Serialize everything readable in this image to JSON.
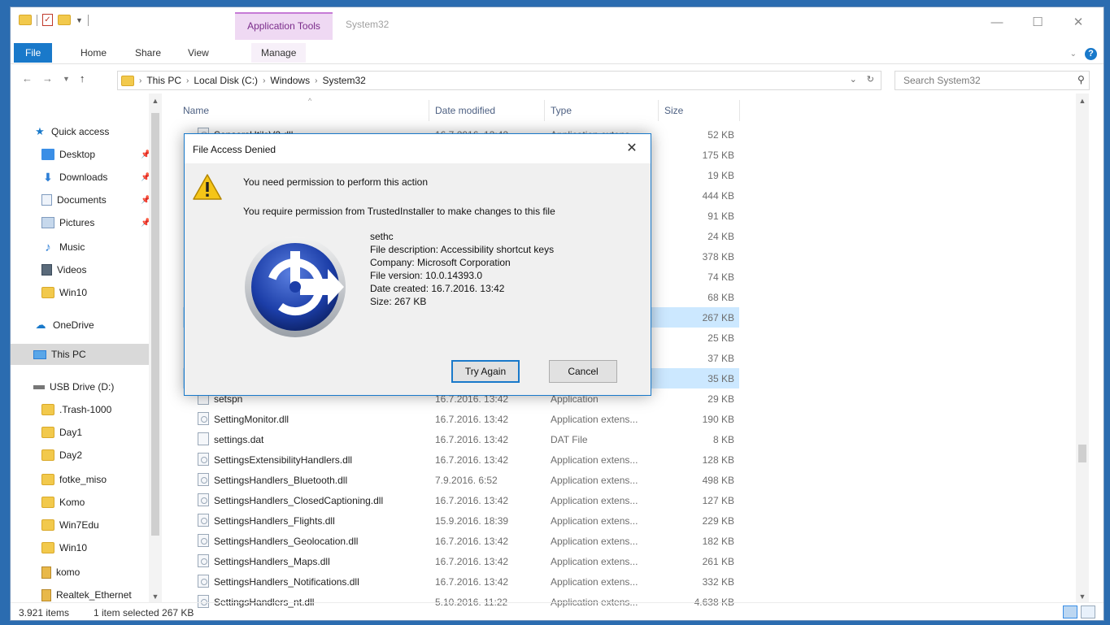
{
  "window": {
    "title": "System32",
    "contextual_tab": "Application Tools",
    "controls": [
      "—",
      "☐",
      "✕"
    ]
  },
  "ribbon": {
    "tabs": [
      "File",
      "Home",
      "Share",
      "View",
      "Manage"
    ]
  },
  "address": {
    "breadcrumbs": [
      "This PC",
      "Local Disk (C:)",
      "Windows",
      "System32"
    ],
    "search_placeholder": "Search System32"
  },
  "nav": {
    "items": [
      {
        "label": "Quick access",
        "icon": "star-icon"
      },
      {
        "label": "Desktop",
        "icon": "desktop-icon",
        "pinned": true
      },
      {
        "label": "Downloads",
        "icon": "download-icon",
        "pinned": true
      },
      {
        "label": "Documents",
        "icon": "documents-icon",
        "pinned": true
      },
      {
        "label": "Pictures",
        "icon": "pictures-icon",
        "pinned": true
      },
      {
        "label": "Music",
        "icon": "music-icon"
      },
      {
        "label": "Videos",
        "icon": "videos-icon"
      },
      {
        "label": "Win10",
        "icon": "folder-icon"
      },
      {
        "label": "OneDrive",
        "icon": "onedrive-icon"
      },
      {
        "label": "This PC",
        "icon": "this-pc-icon",
        "selected": true
      },
      {
        "label": "USB Drive (D:)",
        "icon": "usb-drive-icon"
      },
      {
        "label": ".Trash-1000",
        "icon": "folder-icon"
      },
      {
        "label": "Day1",
        "icon": "folder-icon"
      },
      {
        "label": "Day2",
        "icon": "folder-icon"
      },
      {
        "label": "fotke_miso",
        "icon": "folder-icon"
      },
      {
        "label": "Komo",
        "icon": "folder-icon"
      },
      {
        "label": "Win7Edu",
        "icon": "folder-icon"
      },
      {
        "label": "Win10",
        "icon": "folder-icon"
      },
      {
        "label": "komo",
        "icon": "zip-folder-icon"
      },
      {
        "label": "Realtek_Ethernet",
        "icon": "zip-folder-icon"
      }
    ]
  },
  "filelist": {
    "columns": [
      "Name",
      "Date modified",
      "Type",
      "Size"
    ],
    "rows": [
      {
        "name": "SensorsUtilsV2.dll",
        "date": "16.7.2016. 13:42",
        "type": "Application extens...",
        "size": "52 KB",
        "kind": "dll"
      },
      {
        "name": "",
        "date": "",
        "type": "",
        "size": "175 KB",
        "kind": "dll"
      },
      {
        "name": "",
        "date": "",
        "type": "",
        "size": "19 KB",
        "kind": "dll"
      },
      {
        "name": "",
        "date": "",
        "type": "",
        "size": "444 KB",
        "kind": "dll"
      },
      {
        "name": "",
        "date": "",
        "type": "",
        "size": "91 KB",
        "kind": "dll"
      },
      {
        "name": "",
        "date": "",
        "type": "",
        "size": "24 KB",
        "kind": "dll"
      },
      {
        "name": "",
        "date": "",
        "type": "",
        "size": "378 KB",
        "kind": "dll"
      },
      {
        "name": "",
        "date": "",
        "type": "",
        "size": "74 KB",
        "kind": "dll"
      },
      {
        "name": "",
        "date": "",
        "type": "",
        "size": "68 KB",
        "kind": "dll"
      },
      {
        "name": "",
        "date": "",
        "type": "",
        "size": "267 KB",
        "kind": "exe",
        "selected": true
      },
      {
        "name": "",
        "date": "",
        "type": "",
        "size": "25 KB",
        "kind": "dll"
      },
      {
        "name": "",
        "date": "",
        "type": "",
        "size": "37 KB",
        "kind": "dll"
      },
      {
        "name": "",
        "date": "",
        "type": "",
        "size": "35 KB",
        "kind": "dll",
        "hover": true
      },
      {
        "name": "setspn",
        "date": "16.7.2016. 13:42",
        "type": "Application",
        "size": "29 KB",
        "kind": "exe"
      },
      {
        "name": "SettingMonitor.dll",
        "date": "16.7.2016. 13:42",
        "type": "Application extens...",
        "size": "190 KB",
        "kind": "dll"
      },
      {
        "name": "settings.dat",
        "date": "16.7.2016. 13:42",
        "type": "DAT File",
        "size": "8 KB",
        "kind": "dat"
      },
      {
        "name": "SettingsExtensibilityHandlers.dll",
        "date": "16.7.2016. 13:42",
        "type": "Application extens...",
        "size": "128 KB",
        "kind": "dll"
      },
      {
        "name": "SettingsHandlers_Bluetooth.dll",
        "date": "7.9.2016. 6:52",
        "type": "Application extens...",
        "size": "498 KB",
        "kind": "dll"
      },
      {
        "name": "SettingsHandlers_ClosedCaptioning.dll",
        "date": "16.7.2016. 13:42",
        "type": "Application extens...",
        "size": "127 KB",
        "kind": "dll"
      },
      {
        "name": "SettingsHandlers_Flights.dll",
        "date": "15.9.2016. 18:39",
        "type": "Application extens...",
        "size": "229 KB",
        "kind": "dll"
      },
      {
        "name": "SettingsHandlers_Geolocation.dll",
        "date": "16.7.2016. 13:42",
        "type": "Application extens...",
        "size": "182 KB",
        "kind": "dll"
      },
      {
        "name": "SettingsHandlers_Maps.dll",
        "date": "16.7.2016. 13:42",
        "type": "Application extens...",
        "size": "261 KB",
        "kind": "dll"
      },
      {
        "name": "SettingsHandlers_Notifications.dll",
        "date": "16.7.2016. 13:42",
        "type": "Application extens...",
        "size": "332 KB",
        "kind": "dll"
      },
      {
        "name": "SettingsHandlers_nt.dll",
        "date": "5.10.2016. 11:22",
        "type": "Application extens...",
        "size": "4.638 KB",
        "kind": "dll"
      }
    ]
  },
  "status": {
    "items_count": "3.921 items",
    "selection": "1 item selected 267 KB"
  },
  "dialog": {
    "title": "File Access Denied",
    "message1": "You need permission to perform this action",
    "message2": "You require permission from TrustedInstaller to make changes to this file",
    "file": {
      "name": "sethc",
      "description": "File description: Accessibility shortcut keys",
      "company": "Company: Microsoft Corporation",
      "version": "File version: 10.0.14393.0",
      "created": "Date created: 16.7.2016. 13:42",
      "size": "Size: 267 KB"
    },
    "buttons": {
      "try_again": "Try Again",
      "cancel": "Cancel"
    }
  },
  "colors": {
    "accent": "#1979ca",
    "contextual_tab": "#efd9f3",
    "selection": "#cce8ff",
    "warning": "#f5c518"
  }
}
